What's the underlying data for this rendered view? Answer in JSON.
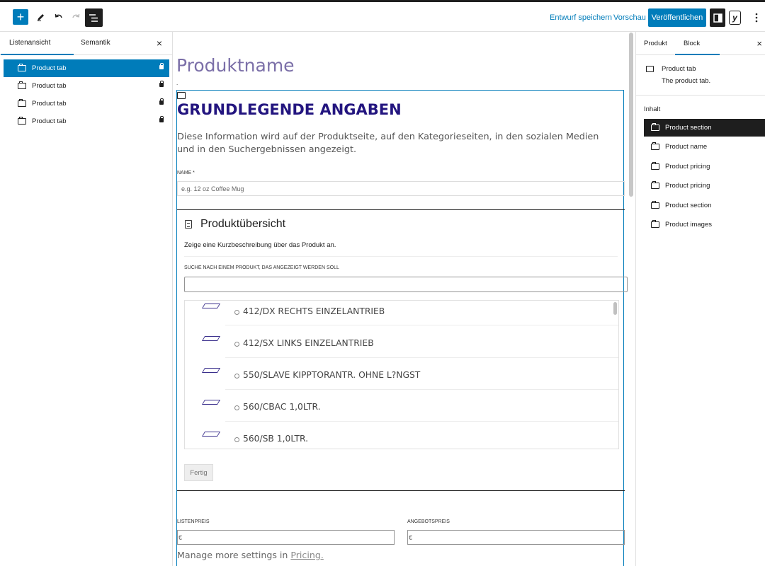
{
  "toolbar": {
    "add_label": "+",
    "save_draft": "Entwurf speichern",
    "preview": "Vorschau",
    "publish": "Veröffentlichen",
    "yoast_label": "y"
  },
  "left_panel": {
    "tabs": [
      "Listenansicht",
      "Semantik"
    ],
    "close_label": "×",
    "items": [
      {
        "label": "Product tab",
        "selected": true
      },
      {
        "label": "Product tab",
        "selected": false
      },
      {
        "label": "Product tab",
        "selected": false
      },
      {
        "label": "Product tab",
        "selected": false
      }
    ]
  },
  "canvas": {
    "title": "Produktname",
    "dot": ".",
    "section": {
      "heading": "GRUNDLEGENDE ANGABEN",
      "description": "Diese Information wird auf der Produktseite, auf den Kategorieseiten, in den sozialen Medien und in den Suchergebnissen angezeigt.",
      "name_label": "NAME *",
      "name_placeholder": "e.g. 12 oz Coffee Mug"
    },
    "overview": {
      "title": "Produktübersicht",
      "description": "Zeige eine Kurzbeschreibung über das Produkt an.",
      "search_label": "SUCHE NACH EINEM PRODUKT, DAS ANGEZEIGT WERDEN SOLL",
      "search_value": "",
      "products": [
        "412/DX RECHTS EINZELANTRIEB",
        "412/SX LINKS EINZELANTRIEB",
        "550/SLAVE KIPPTORANTR. OHNE L?NGST",
        "560/CBAC 1,0LTR.",
        "560/SB 1,0LTR."
      ],
      "done_button": "Fertig"
    },
    "pricing": {
      "list_price_label": "LISTENPREIS",
      "list_price_value": "€",
      "sale_price_label": "ANGEBOTSPREIS",
      "sale_price_value": "€",
      "manage_text": "Manage more settings in ",
      "manage_link": "Pricing."
    }
  },
  "right_panel": {
    "tabs": [
      "Produkt",
      "Block"
    ],
    "close_label": "×",
    "block_name": "Product tab",
    "block_description": "The product tab.",
    "content_heading": "Inhalt",
    "items": [
      {
        "label": "Product section",
        "selected": true
      },
      {
        "label": "Product name",
        "selected": false
      },
      {
        "label": "Product pricing",
        "selected": false
      },
      {
        "label": "Product pricing",
        "selected": false
      },
      {
        "label": "Product section",
        "selected": false
      },
      {
        "label": "Product images",
        "selected": false
      }
    ]
  },
  "colors": {
    "accent": "#007cba",
    "title": "#7b6fa8",
    "heading": "#23157f",
    "dark": "#1e1e1e"
  }
}
